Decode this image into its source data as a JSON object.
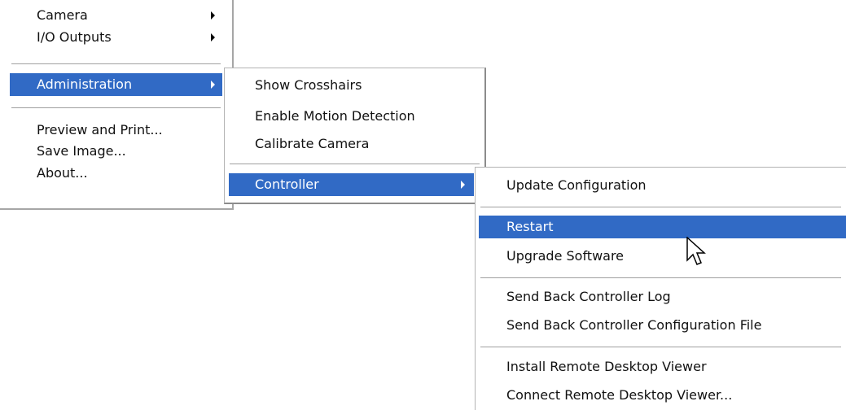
{
  "main_menu": {
    "items": [
      {
        "label": "Camera",
        "submenu": true
      },
      {
        "label": "I/O Outputs",
        "submenu": true
      },
      {
        "label": "Administration",
        "submenu": true,
        "highlighted": true
      },
      {
        "label": "Preview and Print..."
      },
      {
        "label": "Save Image..."
      },
      {
        "label": "About..."
      }
    ]
  },
  "admin_menu": {
    "items": [
      {
        "label": "Show Crosshairs"
      },
      {
        "label": "Enable Motion Detection"
      },
      {
        "label": "Calibrate Camera"
      },
      {
        "label": "Controller",
        "submenu": true,
        "highlighted": true
      }
    ]
  },
  "controller_menu": {
    "items": [
      {
        "label": "Update Configuration"
      },
      {
        "label": "Restart",
        "highlighted": true
      },
      {
        "label": "Upgrade Software"
      },
      {
        "label": "Send Back Controller Log"
      },
      {
        "label": "Send Back Controller Configuration File"
      },
      {
        "label": "Install Remote Desktop Viewer"
      },
      {
        "label": "Connect Remote Desktop Viewer..."
      }
    ]
  },
  "colors": {
    "highlight": "#316ac5",
    "highlight_text": "#ffffff",
    "menu_background": "#ffffff",
    "separator": "#a0a0a0"
  },
  "icons": {
    "submenu_arrow": "chevron-right-icon",
    "cursor": "mouse-pointer-icon"
  }
}
